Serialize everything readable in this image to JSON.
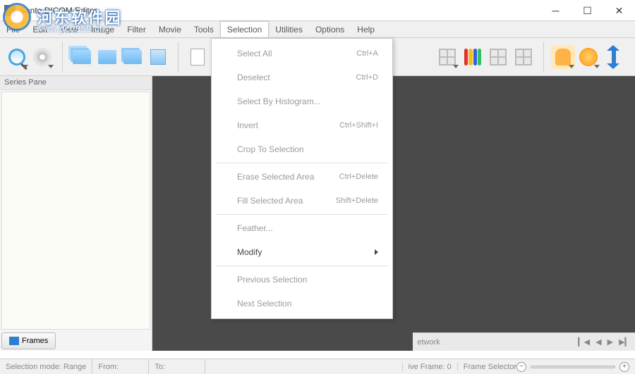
{
  "window": {
    "title": "Sante DICOM Editor"
  },
  "watermark": {
    "text": "河东软件园",
    "sub": "www.pc0359.cn"
  },
  "menu": {
    "items": [
      "File",
      "Edit",
      "View",
      "Image",
      "Filter",
      "Movie",
      "Tools",
      "Selection",
      "Utilities",
      "Options",
      "Help"
    ],
    "active": "Selection"
  },
  "dropdown": {
    "items": [
      {
        "label": "Select All",
        "shortcut": "Ctrl+A",
        "enabled": false
      },
      {
        "label": "Deselect",
        "shortcut": "Ctrl+D",
        "enabled": false
      },
      {
        "label": "Select By Histogram...",
        "shortcut": "",
        "enabled": false
      },
      {
        "label": "Invert",
        "shortcut": "Ctrl+Shift+I",
        "enabled": false
      },
      {
        "label": "Crop To Selection",
        "shortcut": "",
        "enabled": false
      },
      {
        "sep": true
      },
      {
        "label": "Erase Selected Area",
        "shortcut": "Ctrl+Delete",
        "enabled": false
      },
      {
        "label": "Fill Selected Area",
        "shortcut": "Shift+Delete",
        "enabled": false
      },
      {
        "sep": true
      },
      {
        "label": "Feather...",
        "shortcut": "",
        "enabled": false
      },
      {
        "label": "Modify",
        "shortcut": "",
        "enabled": true,
        "submenu": true
      },
      {
        "sep": true
      },
      {
        "label": "Previous Selection",
        "shortcut": "",
        "enabled": false
      },
      {
        "label": "Next Selection",
        "shortcut": "",
        "enabled": false
      }
    ]
  },
  "series_pane": {
    "title": "Series Pane",
    "tab": "Frames"
  },
  "viewer_bar": {
    "label": "etwork",
    "active_frame_label": "ive Frame:",
    "active_frame_value": "0"
  },
  "status": {
    "mode_label": "Selection mode: Range",
    "from": "From:",
    "to": "To:",
    "frame_selector": "Frame Selector"
  }
}
